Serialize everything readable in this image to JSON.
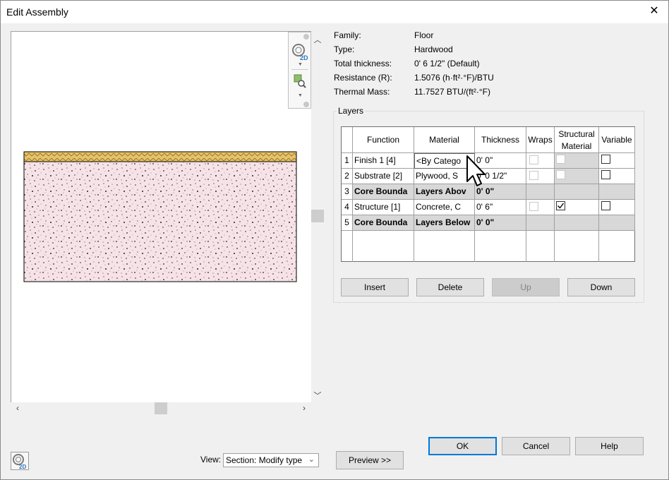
{
  "window": {
    "title": "Edit Assembly"
  },
  "info": {
    "family_label": "Family:",
    "family_value": "Floor",
    "type_label": "Type:",
    "type_value": "Hardwood",
    "thickness_label": "Total thickness:",
    "thickness_value": "0'  6 1/2\" (Default)",
    "resistance_label": "Resistance (R):",
    "resistance_value": "1.5076 (h·ft²·°F)/BTU",
    "mass_label": "Thermal Mass:",
    "mass_value": "11.7527 BTU/(ft²·°F)"
  },
  "layers": {
    "legend": "Layers",
    "columns": {
      "function": "Function",
      "material": "Material",
      "thickness": "Thickness",
      "wraps": "Wraps",
      "structural_line1": "Structural",
      "structural_line2": "Material",
      "variable": "Variable"
    },
    "rows": [
      {
        "num": "1",
        "function": "Finish 1 [4]",
        "material": "<By Catego",
        "thickness": "0'  0\"",
        "structural_checked": false,
        "variable_checked": false
      },
      {
        "num": "2",
        "function": "Substrate [2]",
        "material": "Plywood, S",
        "thickness": "0'  0 1/2\"",
        "structural_checked": false,
        "variable_checked": false
      },
      {
        "num": "3",
        "function": "Core Bounda",
        "material": "Layers Abov",
        "thickness": "0'  0\""
      },
      {
        "num": "4",
        "function": "Structure [1]",
        "material": "Concrete, C",
        "thickness": "0'  6\"",
        "structural_checked": true,
        "variable_checked": false
      },
      {
        "num": "5",
        "function": "Core Bounda",
        "material": "Layers Below",
        "thickness": "0'  0\""
      }
    ],
    "buttons": {
      "insert": "Insert",
      "delete": "Delete",
      "up": "Up",
      "down": "Down"
    }
  },
  "footer": {
    "view_label": "View:",
    "view_value": "Section: Modify type",
    "preview_button": "Preview >>",
    "ok_button": "OK",
    "cancel_button": "Cancel",
    "help_button": "Help"
  },
  "icons": [
    "close-icon",
    "view-cube-2d-icon",
    "zoom-icon",
    "scroll-up-icon",
    "scroll-down-icon",
    "scroll-left-icon",
    "scroll-right-icon",
    "dropdown-chevron-icon",
    "mouse-cursor-icon"
  ]
}
